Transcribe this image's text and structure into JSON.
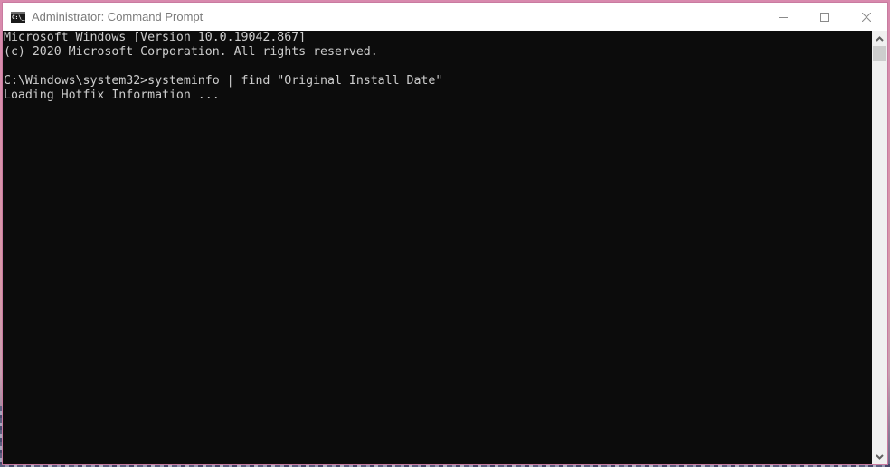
{
  "window": {
    "title": "Administrator: Command Prompt",
    "app_icon": "cmd-icon",
    "app_icon_text": "C:\\_",
    "controls": [
      {
        "name": "minimize",
        "icon": "minimize-icon"
      },
      {
        "name": "maximize",
        "icon": "maximize-icon"
      },
      {
        "name": "close",
        "icon": "close-icon"
      }
    ]
  },
  "console": {
    "lines": [
      "Microsoft Windows [Version 10.0.19042.867]",
      "(c) 2020 Microsoft Corporation. All rights reserved.",
      "",
      "C:\\Windows\\system32>systeminfo | find \"Original Install Date\"",
      "Loading Hotfix Information ..."
    ],
    "text_color": "#cccccc",
    "background_color": "#0c0c0c"
  },
  "scrollbar": {
    "up_icon": "scroll-up-arrow-icon",
    "down_icon": "scroll-down-arrow-icon",
    "position_fraction": 0
  }
}
